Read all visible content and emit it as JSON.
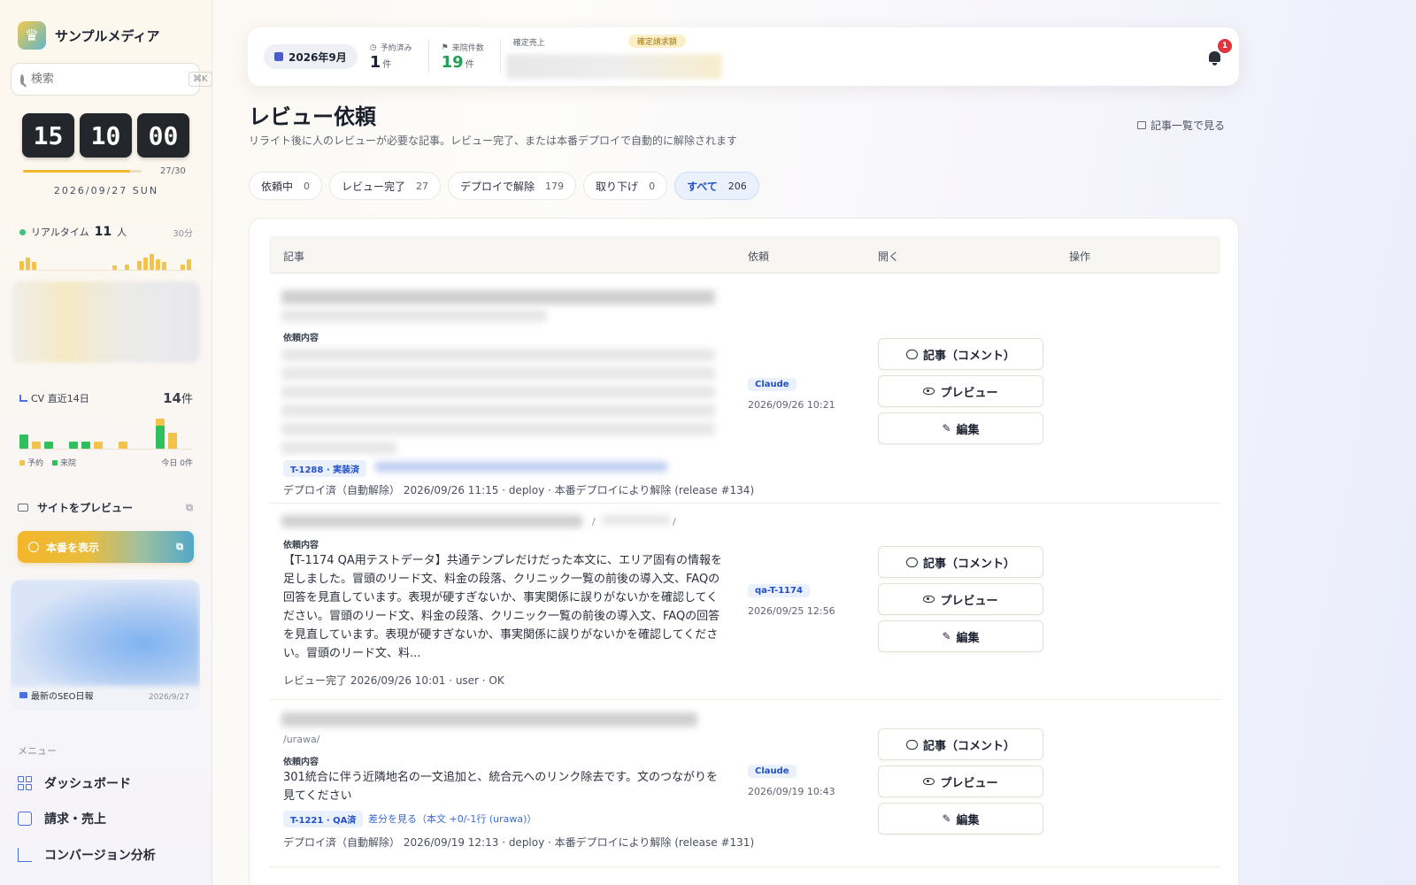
{
  "sidebar": {
    "brand": "サンプルメディア",
    "search_placeholder": "検索",
    "search_shortcut": "⌘K",
    "clock": {
      "h": "15",
      "m": "10",
      "s": "00"
    },
    "progress": {
      "label": "27/30",
      "value": 27,
      "max": 30
    },
    "date": "2026/09/27 SUN",
    "realtime": {
      "label": "リアルタイム",
      "count": "11",
      "unit": "人",
      "range": "30分",
      "bars": [
        10,
        14,
        9,
        0,
        0,
        0,
        0,
        0,
        0,
        0,
        0,
        0,
        0,
        0,
        0,
        5,
        0,
        6,
        0,
        10,
        14,
        18,
        12,
        9,
        0,
        0,
        6,
        12
      ]
    },
    "cv": {
      "label": "CV 直近14日",
      "count": "14",
      "unit": "件",
      "reserve_label": "予約",
      "visit_label": "来院",
      "today_label": "今日 0件",
      "bars": [
        {
          "visit": 16,
          "reserve": 0
        },
        {
          "visit": 0,
          "reserve": 8
        },
        {
          "visit": 8,
          "reserve": 0
        },
        {
          "visit": 0,
          "reserve": 0
        },
        {
          "visit": 8,
          "reserve": 0
        },
        {
          "visit": 8,
          "reserve": 0
        },
        {
          "visit": 0,
          "reserve": 8
        },
        {
          "visit": 0,
          "reserve": 0
        },
        {
          "visit": 0,
          "reserve": 8
        },
        {
          "visit": 0,
          "reserve": 0
        },
        {
          "visit": 0,
          "reserve": 0
        },
        {
          "visit": 26,
          "reserve": 8
        },
        {
          "visit": 0,
          "reserve": 18
        },
        {
          "visit": 0,
          "reserve": 0
        }
      ]
    },
    "preview_site": "サイトをプレビュー",
    "view_live": "本番を表示",
    "seo": {
      "label": "最新のSEO日報",
      "date": "2026/9/27"
    },
    "menu_title": "メニュー",
    "nav": [
      {
        "label": "ダッシュボード"
      },
      {
        "label": "請求・売上"
      },
      {
        "label": "コンバージョン分析"
      }
    ]
  },
  "topbar": {
    "month": "2026年9月",
    "kpis": [
      {
        "label": "予約済み",
        "value": "1",
        "unit": "件",
        "color": "#1d2230"
      },
      {
        "label": "来院件数",
        "value": "19",
        "unit": "件",
        "color": "#1f9e55"
      }
    ],
    "sales_label": "確定売上",
    "billing_label": "確定請求額",
    "notifications": "1"
  },
  "page": {
    "title": "レビュー依頼",
    "subtitle": "リライト後に人のレビューが必要な記事。レビュー完了、または本番デプロイで自動的に解除されます",
    "view_list": "記事一覧で見る"
  },
  "filters": [
    {
      "label": "依頼中",
      "count": "0"
    },
    {
      "label": "レビュー完了",
      "count": "27"
    },
    {
      "label": "デプロイで解除",
      "count": "179"
    },
    {
      "label": "取り下げ",
      "count": "0"
    },
    {
      "label": "すべて",
      "count": "206",
      "active": true
    }
  ],
  "table": {
    "headers": {
      "article": "記事",
      "request": "依頼",
      "open": "開く",
      "action": "操作"
    },
    "buttons": {
      "comment": "記事（コメント）",
      "preview": "プレビュー",
      "edit": "編集"
    },
    "req_label": "依頼内容",
    "rows": [
      {
        "tag": "T-1288 · 実装済",
        "status": "デプロイ済（自動解除） 2026/09/26 11:15 · deploy · 本番デプロイにより解除 (release #134)",
        "who": "Claude",
        "when": "2026/09/26 10:21"
      },
      {
        "text": "【T-1174 QA用テストデータ】共通テンプレだけだった本文に、エリア固有の情報を足しました。冒頭のリード文、料金の段落、クリニック一覧の前後の導入文、FAQの回答を見直しています。表現が硬すぎないか、事実関係に誤りがないかを確認してください。冒頭のリード文、料金の段落、クリニック一覧の前後の導入文、FAQの回答を見直しています。表現が硬すぎないか、事実関係に誤りがないかを確認してください。冒頭のリード文、料...",
        "status": "レビュー完了 2026/09/26 10:01 · user · OK",
        "who": "qa-T-1174",
        "when": "2026/09/25 12:56"
      },
      {
        "path": "/urawa/",
        "text": "301統合に伴う近隣地名の一文追加と、統合元へのリンク除去です。文のつながりを見てください",
        "tag": "T-1221 · QA済",
        "diff": "差分を見る（本文 +0/-1行 (urawa)）",
        "status": "デプロイ済（自動解除） 2026/09/19 12:13 · deploy · 本番デプロイにより解除 (release #131)",
        "who": "Claude",
        "when": "2026/09/19 10:43"
      }
    ]
  },
  "colors": {
    "accent": "#2150c8",
    "reserve": "#f3c24a",
    "visit": "#2fbf5c",
    "badge": "#e0343f"
  }
}
